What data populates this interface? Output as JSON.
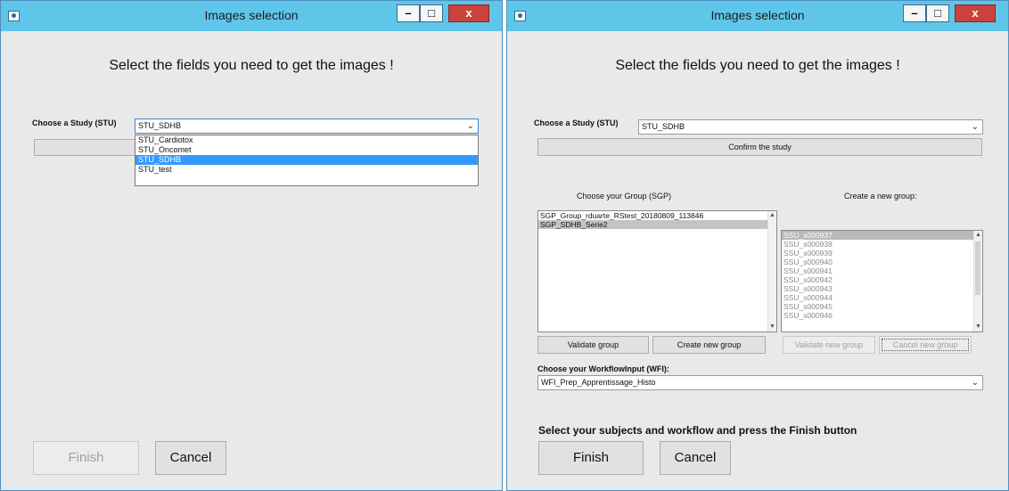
{
  "left_window": {
    "title": "Images selection",
    "controls": {
      "minimize": "–",
      "maximize": "□",
      "close": "x"
    },
    "heading": "Select the fields you need to get the images !",
    "study_label": "Choose a Study (STU)",
    "study_value": "STU_SDHB",
    "study_options": [
      "STU_Cardiotox",
      "STU_Oncomet",
      "STU_SDHB",
      "STU_test"
    ],
    "selected_option": "STU_SDHB",
    "finish_label": "Finish",
    "cancel_label": "Cancel"
  },
  "right_window": {
    "title": "Images selection",
    "controls": {
      "minimize": "–",
      "maximize": "□",
      "close": "x"
    },
    "heading": "Select the fields you need to get the images !",
    "study_label": "Choose a Study (STU)",
    "study_value": "STU_SDHB",
    "confirm_label": "Confirm the study",
    "group_label": "Choose your Group (SGP)",
    "new_group_label": "Create a new group:",
    "groups": [
      "SGP_Group_rduarte_RStest_20180809_113846",
      "SGP_SDHB_Serie2"
    ],
    "selected_group": "SGP_SDHB_Serie2",
    "subjects": [
      "SSU_s000937",
      "SSU_s000938",
      "SSU_s000939",
      "SSU_s000940",
      "SSU_s000941",
      "SSU_s000942",
      "SSU_s000943",
      "SSU_s000944",
      "SSU_s000945",
      "SSU_s000946"
    ],
    "selected_subject": "SSU_s000937",
    "validate_group_label": "Validate group",
    "create_group_label": "Create new group",
    "validate_new_group_label": "Validate new group",
    "cancel_new_group_label": "Cancel new group",
    "workflow_label": "Choose your WorkflowInput (WFI):",
    "workflow_value": "WFI_Prep_Apprentissage_Histo",
    "instruction": "Select your subjects and workflow and press the Finish button",
    "finish_label": "Finish",
    "cancel_label": "Cancel"
  }
}
